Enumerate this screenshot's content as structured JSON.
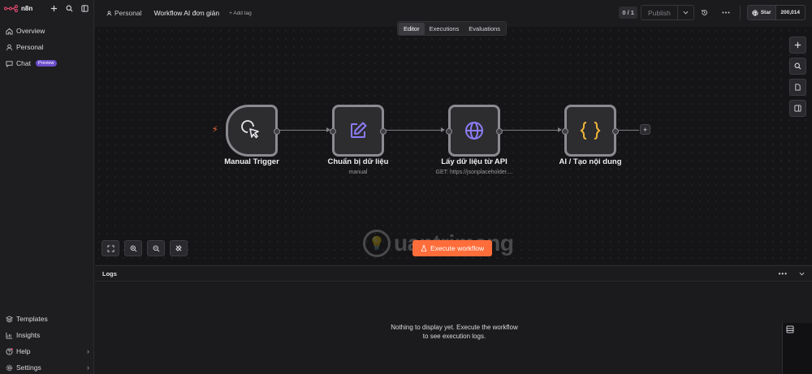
{
  "brand": {
    "name": "n8n",
    "accent": "#ff6d3a"
  },
  "sidebar": {
    "actions": [
      {
        "icon": "plus-icon",
        "glyph": "+"
      },
      {
        "icon": "search-icon",
        "glyph": "⌕"
      },
      {
        "icon": "panel-toggle-icon",
        "glyph": "▣"
      }
    ],
    "nav": [
      {
        "label": "Overview",
        "icon": "home-icon"
      },
      {
        "label": "Personal",
        "icon": "user-icon"
      },
      {
        "label": "Chat",
        "icon": "chat-icon",
        "badge": "Preview"
      }
    ],
    "bottom": [
      {
        "label": "Templates",
        "icon": "templates-icon"
      },
      {
        "label": "Insights",
        "icon": "insights-icon"
      },
      {
        "label": "Help",
        "icon": "help-icon"
      },
      {
        "label": "Settings",
        "icon": "settings-icon"
      }
    ]
  },
  "header": {
    "breadcrumb": "Personal",
    "workflow_name": "Workflow AI đơn giản",
    "add_tag": "+ Add tag",
    "count": "0 / 1",
    "publish": "Publish",
    "github_star": "Star",
    "github_count": "200,014"
  },
  "tabs": [
    {
      "label": "Editor",
      "active": true
    },
    {
      "label": "Executions",
      "active": false
    },
    {
      "label": "Evaluations",
      "active": false
    }
  ],
  "nodes": [
    {
      "title": "Manual Trigger",
      "subtitle": "",
      "icon": "cursor-click-icon"
    },
    {
      "title": "Chuẩn bị dữ liệu",
      "subtitle": "manual",
      "icon": "edit-pencil-icon",
      "icon_color": "#8b7cf6"
    },
    {
      "title": "Lấy dữ liệu từ API",
      "subtitle": "GET: https://jsonplaceholder....",
      "icon": "globe-icon",
      "icon_color": "#8b7cf6"
    },
    {
      "title": "AI / Tạo nội dung",
      "subtitle": "",
      "icon": "code-braces-icon",
      "icon_color": "#f2b53b"
    }
  ],
  "canvas": {
    "execute_button": "Execute workflow",
    "watermark": "uantrimang"
  },
  "logs": {
    "title": "Logs",
    "empty_message": "Nothing to display yet. Execute the workflow to see execution logs."
  }
}
